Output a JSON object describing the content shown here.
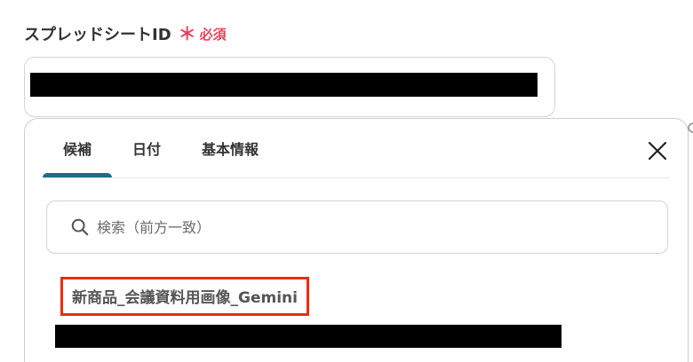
{
  "field": {
    "label": "スプレッドシートID",
    "required_mark": "＊",
    "required_text": "必須"
  },
  "tabs": [
    {
      "label": "候補",
      "active": true
    },
    {
      "label": "日付",
      "active": false
    },
    {
      "label": "基本情報",
      "active": false
    }
  ],
  "search": {
    "placeholder": "検索（前方一致）"
  },
  "candidates": [
    {
      "label": "新商品_会議資料用画像_Gemini",
      "highlighted": true
    }
  ],
  "icons": {
    "close": "close-icon",
    "search": "search-icon"
  },
  "colors": {
    "required": "#e8425a",
    "active_tab": "#1e6d8f",
    "highlight_border": "#f02b0e"
  }
}
